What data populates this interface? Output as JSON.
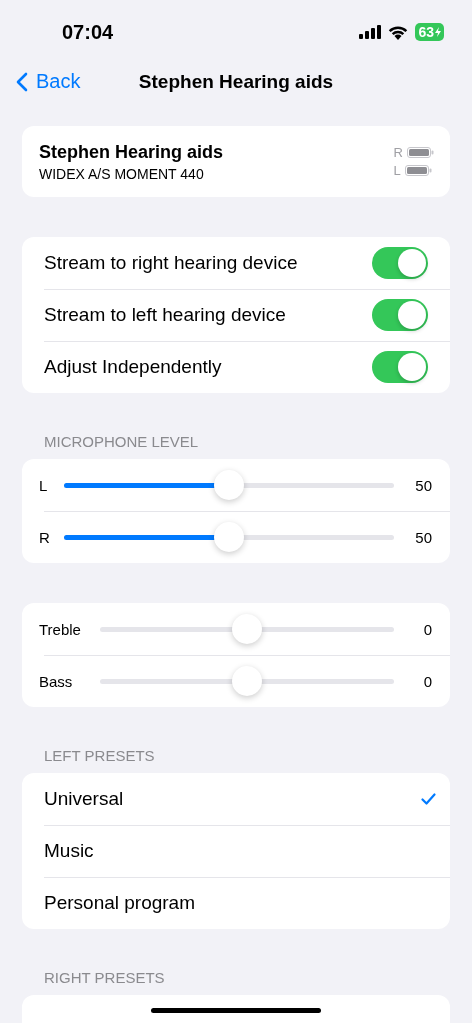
{
  "status_bar": {
    "time": "07:04",
    "battery": "63"
  },
  "nav": {
    "back": "Back",
    "title": "Stephen Hearing aids"
  },
  "device": {
    "name": "Stephen Hearing aids",
    "model": "WIDEX A/S MOMENT 440",
    "batteries": [
      {
        "side": "R"
      },
      {
        "side": "L"
      }
    ]
  },
  "toggles": [
    {
      "label": "Stream to right hearing device",
      "on": true
    },
    {
      "label": "Stream to left hearing device",
      "on": true
    },
    {
      "label": "Adjust Independently",
      "on": true
    }
  ],
  "microphone": {
    "header": "MICROPHONE LEVEL",
    "sliders": [
      {
        "label": "L",
        "level": 0.5,
        "reading": "50"
      },
      {
        "label": "R",
        "level": 0.5,
        "reading": "50"
      }
    ]
  },
  "tone": {
    "sliders": [
      {
        "label": "Treble",
        "level": 0.5,
        "reading": "0"
      },
      {
        "label": "Bass",
        "level": 0.5,
        "reading": "0"
      }
    ]
  },
  "left_presets": {
    "header": "LEFT PRESETS",
    "items": [
      {
        "label": "Universal",
        "selected": true
      },
      {
        "label": "Music",
        "selected": false
      },
      {
        "label": "Personal program",
        "selected": false
      }
    ]
  },
  "right_presets": {
    "header": "RIGHT PRESETS"
  }
}
